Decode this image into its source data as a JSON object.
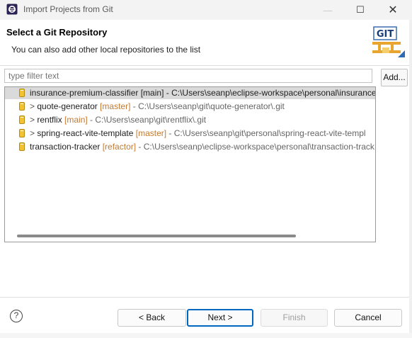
{
  "window": {
    "title": "Import Projects from Git",
    "minimize_glyph": "—",
    "maximize_glyph": "☐",
    "close_glyph": "✕"
  },
  "header": {
    "title": "Select a Git Repository",
    "description": "You can also add other local repositories to the list",
    "logo_text": "GIT"
  },
  "filter": {
    "placeholder": "type filter text"
  },
  "add_button": "Add...",
  "repositories": [
    {
      "chevron": "",
      "name": "insurance-premium-classifier",
      "branch": "[main]",
      "branch_style": "normal",
      "path": " - C:\\Users\\seanp\\eclipse-workspace\\personal\\insurance",
      "selected": true
    },
    {
      "chevron": "> ",
      "name": "quote-generator",
      "branch": "[master]",
      "branch_style": "orange",
      "path": " - C:\\Users\\seanp\\git\\quote-generator\\.git",
      "selected": false
    },
    {
      "chevron": "> ",
      "name": "rentflix",
      "branch": "[main]",
      "branch_style": "orange",
      "path": " - C:\\Users\\seanp\\git\\rentflix\\.git",
      "selected": false
    },
    {
      "chevron": "> ",
      "name": "spring-react-vite-template",
      "branch": "[master]",
      "branch_style": "orange",
      "path": " - C:\\Users\\seanp\\git\\personal\\spring-react-vite-templ",
      "selected": false
    },
    {
      "chevron": "",
      "name": "transaction-tracker",
      "branch": "[refactor]",
      "branch_style": "orange",
      "path": " - C:\\Users\\seanp\\eclipse-workspace\\personal\\transaction-track",
      "selected": false
    }
  ],
  "buttons": {
    "help": "?",
    "back": "< Back",
    "next": "Next >",
    "finish": "Finish",
    "cancel": "Cancel"
  },
  "colors": {
    "branch_orange": "#c67a2e",
    "default_button_border": "#0067c0",
    "selection": "#dadada"
  }
}
